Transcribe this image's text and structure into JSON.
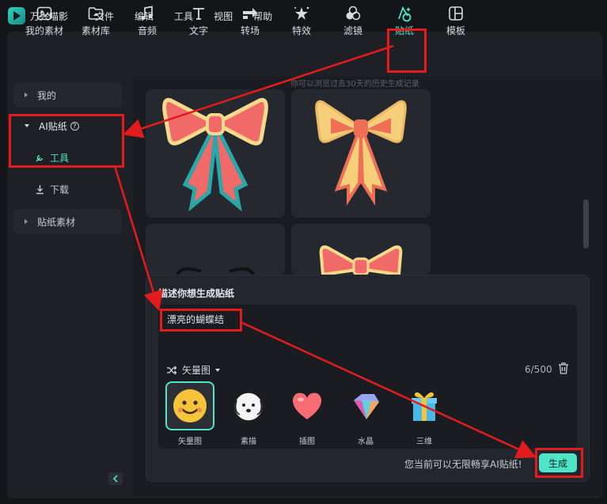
{
  "app": {
    "name": "万兴喵影"
  },
  "menu": [
    "文件",
    "编辑",
    "工具",
    "视图",
    "帮助"
  ],
  "toolbar": {
    "tabs": [
      {
        "label": "我的素材",
        "icon": "my-media-icon"
      },
      {
        "label": "素材库",
        "icon": "library-icon"
      },
      {
        "label": "音频",
        "icon": "music-note-icon"
      },
      {
        "label": "文字",
        "icon": "text-icon"
      },
      {
        "label": "转场",
        "icon": "transition-icon"
      },
      {
        "label": "特效",
        "icon": "effects-icon"
      },
      {
        "label": "滤镜",
        "icon": "filter-icon"
      },
      {
        "label": "贴纸",
        "icon": "sticker-icon"
      },
      {
        "label": "模板",
        "icon": "template-icon"
      }
    ],
    "active": "贴纸",
    "hint": "你可以浏览过去30天的历史生成记录"
  },
  "sidebar": {
    "mine": "我的",
    "ai_sticker": "AI贴纸",
    "tools": "工具",
    "download": "下载",
    "sticker_assets": "贴纸素材"
  },
  "panel": {
    "title": "描述你想生成贴纸",
    "prompt": "漂亮的蝴蝶结",
    "style_selected": "矢量图",
    "counter": "6/500",
    "styles": [
      {
        "label": "矢量图",
        "icon": "smiley-face-icon"
      },
      {
        "label": "素描",
        "icon": "sketch-dog-icon"
      },
      {
        "label": "插图",
        "icon": "heart-icon"
      },
      {
        "label": "水晶",
        "icon": "crystal-icon"
      },
      {
        "label": "三维",
        "icon": "gift-box-icon"
      }
    ],
    "notice": "您当前可以无限畅享AI贴纸!",
    "generate_label": "生成"
  },
  "colors": {
    "accent": "#4fe3c8",
    "annotation": "#e21c1c",
    "background": "#1e2026"
  }
}
